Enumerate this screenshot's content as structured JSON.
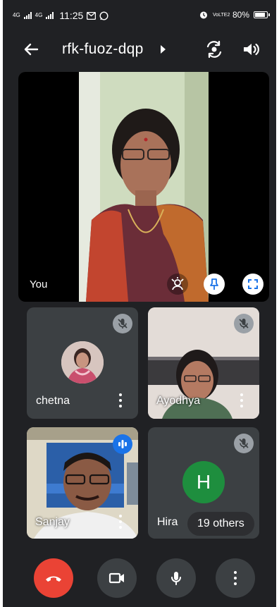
{
  "status_bar": {
    "net1": "4G",
    "net2": "4G",
    "time": "11:25",
    "vo_lte": "VoLTE2",
    "battery": "80%"
  },
  "app_bar": {
    "meeting_code": "rfk-fuoz-dqp",
    "icons": [
      "back-arrow-icon",
      "chevron-right-icon",
      "switch-camera-icon",
      "speaker-icon"
    ]
  },
  "self_tile": {
    "label": "You",
    "icons": [
      "voice-effects-icon",
      "pin-icon",
      "fullscreen-icon"
    ]
  },
  "participants": [
    {
      "name": "chetna",
      "muted": true
    },
    {
      "name": "Ayodhya",
      "muted": true
    },
    {
      "name": "Sanjay",
      "muted": false,
      "speaking": true
    },
    {
      "name": "Hira",
      "muted": true,
      "initial": "H"
    }
  ],
  "others_label": "19 others",
  "controls": {
    "icons": [
      "end-call-icon",
      "video-camera-icon",
      "microphone-icon",
      "more-options-icon"
    ]
  },
  "colors": {
    "background": "#202124",
    "tile": "#3c4043",
    "end_call": "#ea4335",
    "speaking_badge": "#1a73e8",
    "hira_avatar": "#1e8e3e"
  }
}
